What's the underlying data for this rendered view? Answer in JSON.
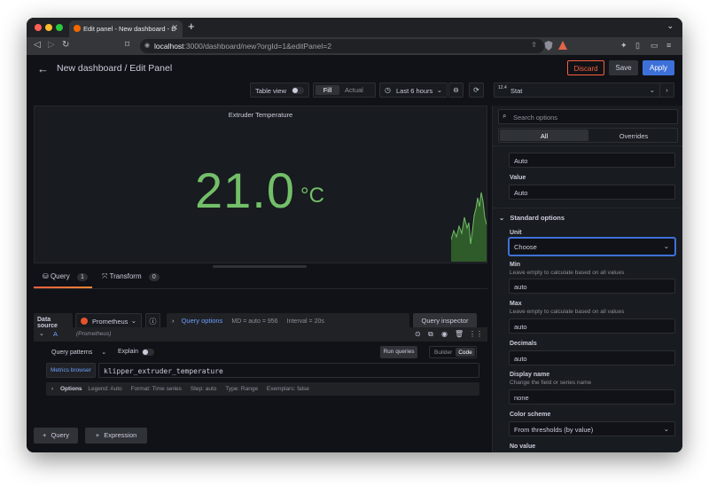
{
  "browser": {
    "tab_title": "Edit panel - New dashboard - D",
    "url_host": "localhost",
    "url_rest": ":3000/dashboard/new?orgId=1&editPanel=2"
  },
  "header": {
    "title": "New dashboard / Edit Panel",
    "discard": "Discard",
    "save": "Save",
    "apply": "Apply"
  },
  "toolbar": {
    "table_view": "Table view",
    "fill": "Fill",
    "actual": "Actual",
    "time_range": "Last 6 hours"
  },
  "visualization": {
    "picker_badge": "12.4",
    "picker_value": "Stat"
  },
  "panel": {
    "title": "Extruder Temperature",
    "value": "21.0",
    "unit": "°C"
  },
  "query_tabs": {
    "query_label": "Query",
    "query_count": "1",
    "transform_label": "Transform",
    "transform_count": "0"
  },
  "datasource": {
    "label": "Data source",
    "name": "Prometheus",
    "query_options": "Query options",
    "md": "MD = auto = 956",
    "interval": "Interval = 20s",
    "inspector": "Query inspector"
  },
  "query": {
    "ref": "A",
    "ds": "(Prometheus)",
    "patterns": "Query patterns",
    "explain": "Explain",
    "run": "Run queries",
    "builder": "Builder",
    "code": "Code",
    "metrics_browser": "Metrics browser",
    "expr": "klipper_extruder_temperature",
    "options_label": "Options",
    "legend": "Legend: Auto",
    "format": "Format: Time series",
    "step": "Step: auto",
    "type": "Type: Range",
    "exemplars": "Exemplars: false"
  },
  "add_buttons": {
    "query": "Query",
    "expression": "Expression"
  },
  "sidebar": {
    "search_placeholder": "Search options",
    "tab_all": "All",
    "tab_overrides": "Overrides",
    "auto_top": "Auto",
    "value_label": "Value",
    "value_value": "Auto",
    "section": "Standard options",
    "unit_label": "Unit",
    "unit_value": "Choose",
    "min_label": "Min",
    "min_desc": "Leave empty to calculate based on all values",
    "min_value": "auto",
    "max_label": "Max",
    "max_desc": "Leave empty to calculate based on all values",
    "max_value": "auto",
    "decimals_label": "Decimals",
    "decimals_value": "auto",
    "display_label": "Display name",
    "display_desc": "Change the field or series name",
    "display_value": "none",
    "scheme_label": "Color scheme",
    "scheme_value": "From thresholds (by value)",
    "novalue_label": "No value"
  },
  "colors": {
    "value_green": "#73bf69",
    "apply_blue": "#3d71d9",
    "discard_red": "#f55f3e",
    "unit_focus_blue": "#3d71d9"
  }
}
